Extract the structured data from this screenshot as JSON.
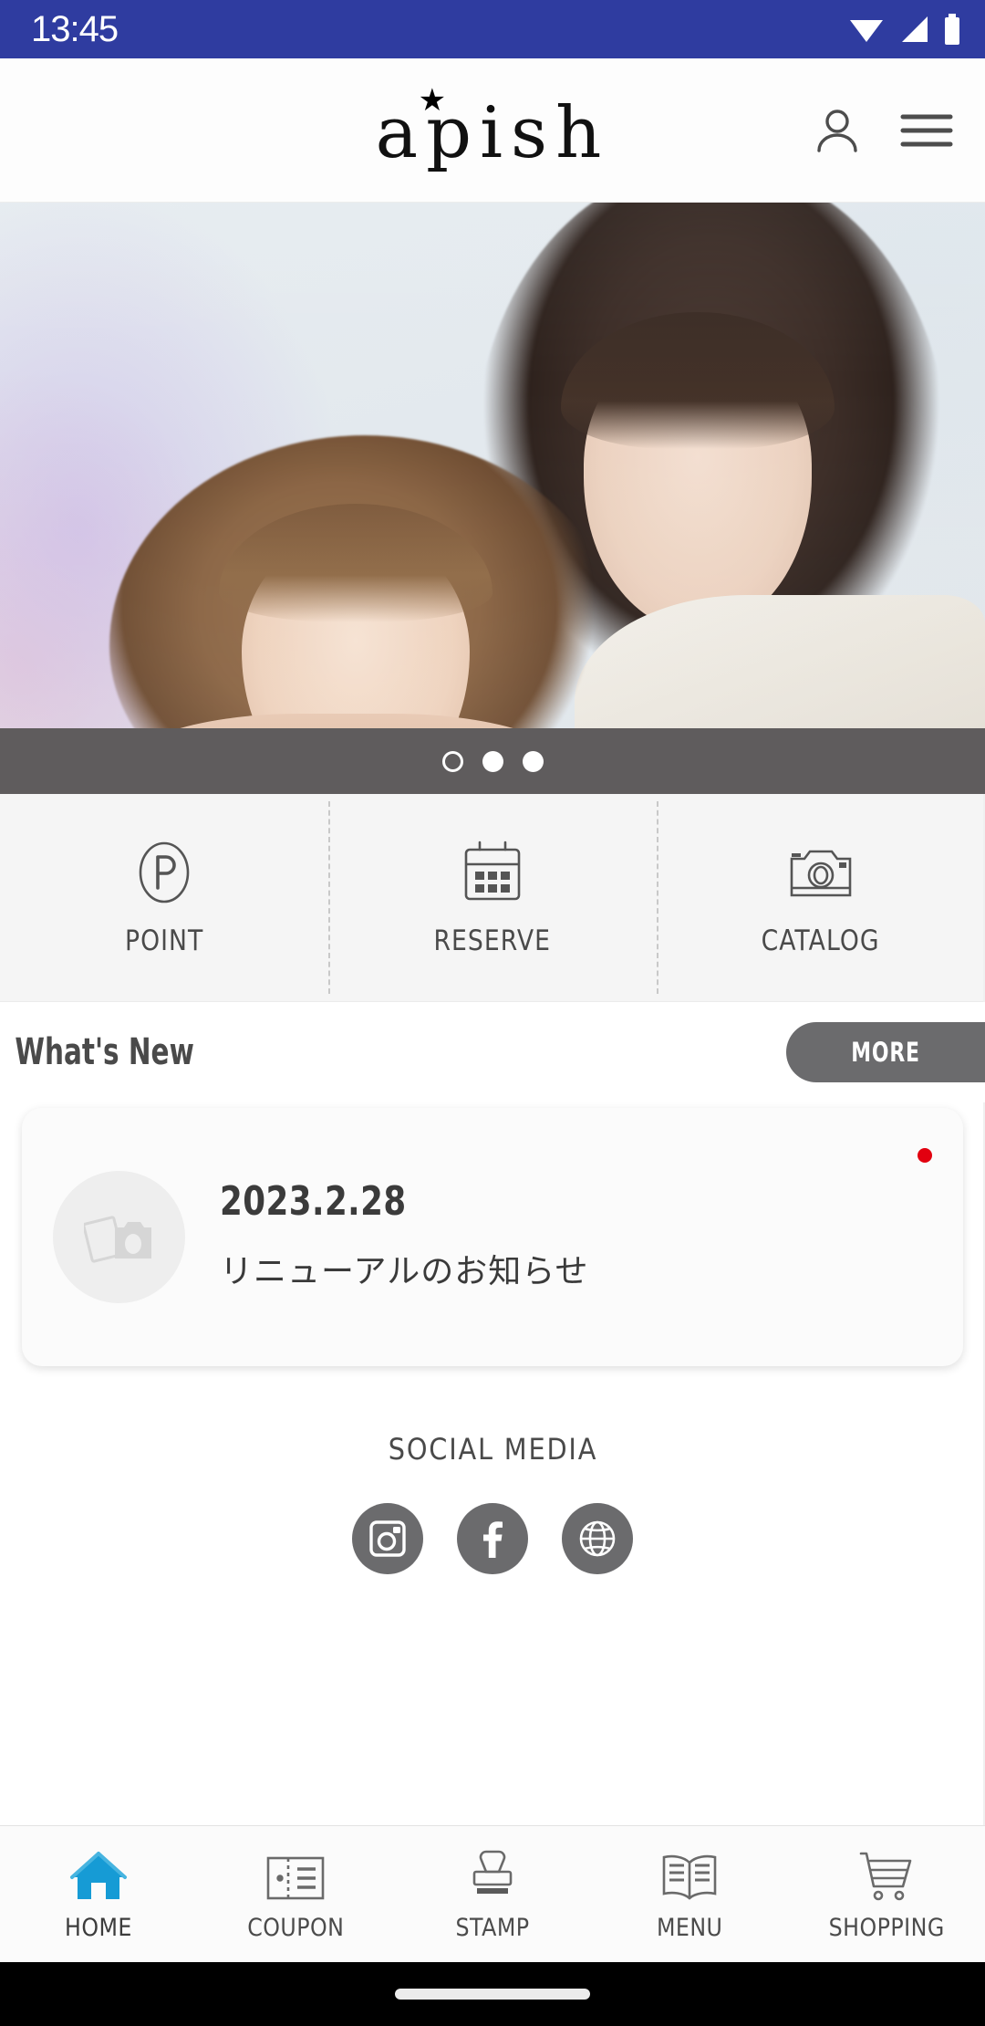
{
  "status_bar": {
    "time": "13:45",
    "icons": [
      "wifi-icon",
      "signal-icon",
      "battery-icon"
    ],
    "background": "#2f3ca0"
  },
  "header": {
    "brand": "apish",
    "brand_star": "★",
    "account_icon": "person-icon",
    "menu_icon": "hamburger-menu-icon"
  },
  "hero": {
    "alt": "two women with styled hair",
    "carousel": {
      "total": 3,
      "active_index": 0,
      "dot_states": [
        "hollow",
        "solid",
        "solid"
      ]
    }
  },
  "quick_actions": [
    {
      "label": "POINT",
      "icon": "point-circle-p-icon"
    },
    {
      "label": "RESERVE",
      "icon": "calendar-icon"
    },
    {
      "label": "CATALOG",
      "icon": "camera-icon"
    }
  ],
  "whats_new": {
    "title": "What's New",
    "more_label": "MORE",
    "more_color": "#6b6b6d",
    "items": [
      {
        "date": "2023.2.28",
        "title": "リニューアルのお知らせ",
        "thumb_icon": "photo-placeholder-icon",
        "unread": true,
        "badge_color": "#e2000f"
      }
    ]
  },
  "social_media": {
    "title": "SOCIAL MEDIA",
    "links": [
      {
        "name": "instagram",
        "icon": "instagram-icon"
      },
      {
        "name": "facebook",
        "icon": "facebook-icon"
      },
      {
        "name": "website",
        "icon": "globe-icon"
      }
    ],
    "circle_color": "#6b6b6d"
  },
  "bottom_nav": {
    "active": "HOME",
    "active_color": "#169bd5",
    "items": [
      {
        "label": "HOME",
        "icon": "home-icon",
        "active": true
      },
      {
        "label": "COUPON",
        "icon": "coupon-ticket-icon",
        "active": false
      },
      {
        "label": "STAMP",
        "icon": "stamp-icon",
        "active": false
      },
      {
        "label": "MENU",
        "icon": "open-book-icon",
        "active": false
      },
      {
        "label": "SHOPPING",
        "icon": "shopping-cart-icon",
        "active": false
      }
    ]
  },
  "gesture_bar": {
    "pill": "home-indicator"
  }
}
